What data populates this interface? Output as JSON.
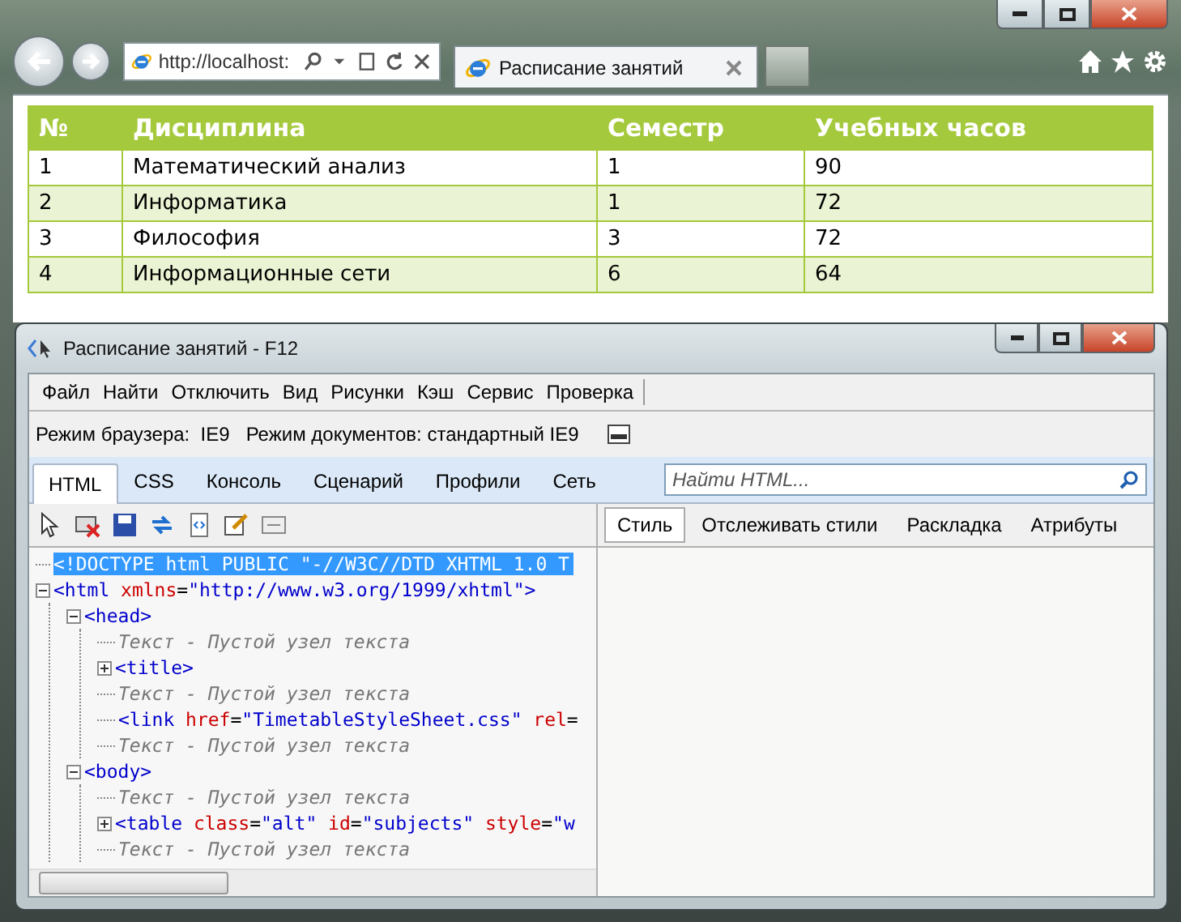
{
  "browser": {
    "address": "http://localhost:",
    "tab": {
      "title": "Расписание занятий",
      "selected": true
    }
  },
  "table": {
    "columns": [
      "№",
      "Дисциплина",
      "Семестр",
      "Учебных часов"
    ],
    "rows": [
      [
        "1",
        "Математический анализ",
        "1",
        "90"
      ],
      [
        "2",
        "Информатика",
        "1",
        "72"
      ],
      [
        "3",
        "Философия",
        "3",
        "72"
      ],
      [
        "4",
        "Информационные сети",
        "6",
        "64"
      ]
    ]
  },
  "devtools": {
    "title": "Расписание занятий - F12",
    "menu": [
      "Файл",
      "Найти",
      "Отключить",
      "Вид",
      "Рисунки",
      "Кэш",
      "Сервис",
      "Проверка"
    ],
    "modes": [
      "Режим браузера:  IE9",
      "Режим документов: стандартный IE9"
    ],
    "tabs": [
      {
        "label": "HTML",
        "selected": true
      },
      {
        "label": "CSS",
        "selected": false
      },
      {
        "label": "Консоль",
        "selected": false
      },
      {
        "label": "Сценарий",
        "selected": false
      },
      {
        "label": "Профили",
        "selected": false
      },
      {
        "label": "Сеть",
        "selected": false
      }
    ],
    "search": {
      "placeholder": "Найти HTML..."
    },
    "side_tabs": [
      {
        "label": "Стиль",
        "selected": true
      },
      {
        "label": "Отслеживать стили",
        "selected": false
      },
      {
        "label": "Раскладка",
        "selected": false
      },
      {
        "label": "Атрибуты",
        "selected": false
      }
    ],
    "tree": [
      {
        "kind": "doctype",
        "selected": true,
        "tokens": [
          {
            "kind": "plain",
            "text": "<!DOCTYPE html PUBLIC \"-//W3C//DTD XHTML 1.0 T"
          }
        ]
      },
      {
        "kind": "element",
        "selected": false,
        "expanded": true,
        "tokens": [
          {
            "kind": "tag",
            "text": "<html"
          },
          {
            "kind": "attr",
            "text": "xmlns"
          },
          {
            "kind": "punct",
            "text": "="
          },
          {
            "kind": "value",
            "text": "\"http://www.w3.org/1999/xhtml\""
          },
          {
            "kind": "tag",
            "text": ">"
          }
        ],
        "children": [
          {
            "kind": "element",
            "selected": false,
            "expanded": true,
            "tokens": [
              {
                "kind": "tag",
                "text": "<head>"
              }
            ],
            "children": [
              {
                "kind": "text",
                "selected": false,
                "tokens": [
                  {
                    "kind": "plain",
                    "text": "Текст - Пустой узел текста"
                  }
                ]
              },
              {
                "kind": "element",
                "selected": false,
                "expanded": false,
                "tokens": [
                  {
                    "kind": "tag",
                    "text": "<title>"
                  }
                ]
              },
              {
                "kind": "text",
                "selected": false,
                "tokens": [
                  {
                    "kind": "plain",
                    "text": "Текст - Пустой узел текста"
                  }
                ]
              },
              {
                "kind": "element",
                "selected": false,
                "tokens": [
                  {
                    "kind": "tag",
                    "text": "<link"
                  },
                  {
                    "kind": "attr",
                    "text": "href"
                  },
                  {
                    "kind": "punct",
                    "text": "="
                  },
                  {
                    "kind": "value",
                    "text": "\"TimetableStyleSheet.css\""
                  },
                  {
                    "kind": "attr",
                    "text": "rel"
                  },
                  {
                    "kind": "punct",
                    "text": "="
                  }
                ]
              },
              {
                "kind": "text",
                "selected": false,
                "tokens": [
                  {
                    "kind": "plain",
                    "text": "Текст - Пустой узел текста"
                  }
                ]
              }
            ]
          },
          {
            "kind": "element",
            "selected": false,
            "expanded": true,
            "tokens": [
              {
                "kind": "tag",
                "text": "<body>"
              }
            ],
            "children": [
              {
                "kind": "text",
                "selected": false,
                "tokens": [
                  {
                    "kind": "plain",
                    "text": "Текст - Пустой узел текста"
                  }
                ]
              },
              {
                "kind": "element",
                "selected": false,
                "expanded": false,
                "tokens": [
                  {
                    "kind": "tag",
                    "text": "<table"
                  },
                  {
                    "kind": "attr",
                    "text": "class"
                  },
                  {
                    "kind": "punct",
                    "text": "="
                  },
                  {
                    "kind": "value",
                    "text": "\"alt\""
                  },
                  {
                    "kind": "attr",
                    "text": "id"
                  },
                  {
                    "kind": "punct",
                    "text": "="
                  },
                  {
                    "kind": "value",
                    "text": "\"subjects\""
                  },
                  {
                    "kind": "attr",
                    "text": "style"
                  },
                  {
                    "kind": "punct",
                    "text": "="
                  },
                  {
                    "kind": "value",
                    "text": "\"w"
                  }
                ]
              },
              {
                "kind": "text",
                "selected": false,
                "tokens": [
                  {
                    "kind": "plain",
                    "text": "Текст - Пустой узел текста"
                  }
                ]
              }
            ]
          }
        ]
      }
    ]
  }
}
